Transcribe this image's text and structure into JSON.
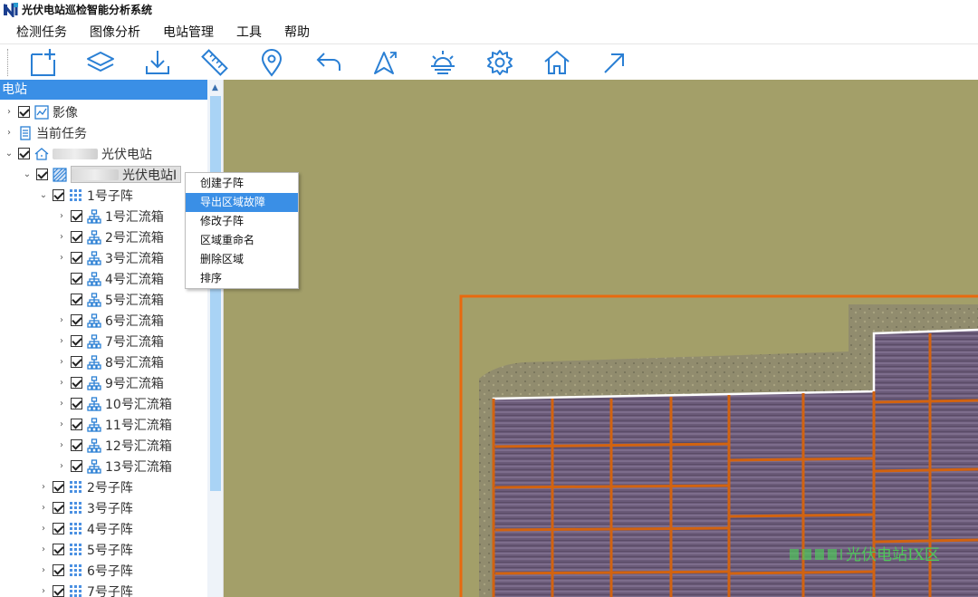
{
  "window": {
    "title": "光伏电站巡检智能分析系统"
  },
  "menu": [
    "检测任务",
    "图像分析",
    "电站管理",
    "工具",
    "帮助"
  ],
  "toolbar_icons": [
    "new-task-icon",
    "layers-icon",
    "download-icon",
    "ruler-icon",
    "location-pin-icon",
    "undo-icon",
    "flight-icon",
    "sunrise-icon",
    "settings-gear-icon",
    "home-icon",
    "arrow-up-right-icon"
  ],
  "colors": {
    "accent": "#3a8fe6",
    "map_bg": "#a39f69",
    "boundary": "#e8690e",
    "label_green": "#4fc65a"
  },
  "sidebar": {
    "header": "电站",
    "tree": {
      "images": "影像",
      "current_task": "当前任务",
      "station": "光伏电站",
      "area": "光伏电站I",
      "sub1": "1号子阵",
      "boxes": [
        "1号汇流箱",
        "2号汇流箱",
        "3号汇流箱",
        "4号汇流箱",
        "5号汇流箱",
        "6号汇流箱",
        "7号汇流箱",
        "8号汇流箱",
        "9号汇流箱",
        "10号汇流箱",
        "11号汇流箱",
        "12号汇流箱",
        "13号汇流箱"
      ],
      "subs": [
        "2号子阵",
        "3号子阵",
        "4号子阵",
        "5号子阵",
        "6号子阵",
        "7号子阵"
      ]
    }
  },
  "context_menu": {
    "items": [
      "创建子阵",
      "导出区域故障",
      "修改子阵",
      "区域重命名",
      "删除区域",
      "排序"
    ],
    "active_index": 1
  },
  "map": {
    "label": "光伏电站IX区"
  }
}
